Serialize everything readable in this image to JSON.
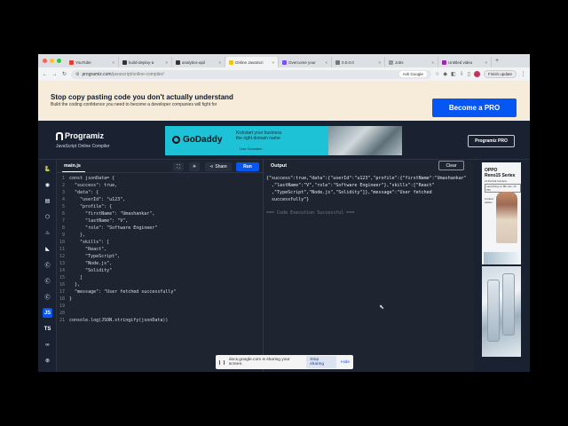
{
  "tabs": [
    {
      "label": "YouTube",
      "color": "#e53935"
    },
    {
      "label": "build-deploy-a",
      "color": "#333333"
    },
    {
      "label": "analytics-apil",
      "color": "#333333"
    },
    {
      "label": "Online JavaScri",
      "color": "#f0c419",
      "active": true
    },
    {
      "label": "Overcome your",
      "color": "#7c4dff"
    },
    {
      "label": "0.0.0.0",
      "color": "#777777"
    },
    {
      "label": "Jobs",
      "color": "#999999"
    },
    {
      "label": "Untitled video",
      "color": "#9c27b0"
    }
  ],
  "address": {
    "url_host": "programiz.com",
    "url_path": "/javascript/online-compiler/",
    "ask_google": "Ask Google",
    "finish_update": "Finish update"
  },
  "banner": {
    "heading": "Stop copy pasting code you don't actually understand",
    "subtext": "Build the coding confidence you need to become a developer companies will fight for",
    "cta": "Become a PRO"
  },
  "header": {
    "logo": "Programiz",
    "subtitle": "JavaScript Online Compiler",
    "ad_brand": "GoDaddy",
    "ad_line1": "Kickstart your business",
    "ad_line2": "the right domain name",
    "ad_credit": "Lisa Gonzales",
    "pro_button": "Programiz PRO"
  },
  "sidebar": {
    "active_language": "JS",
    "items": [
      "python",
      "r",
      "sql",
      "html",
      "java",
      "kotlin",
      "c",
      "cpp",
      "csharp",
      "JS",
      "TS",
      "go",
      "swift"
    ]
  },
  "editor": {
    "filename": "main.js",
    "share_label": "Share",
    "run_label": "Run",
    "lines": [
      {
        "n": "1",
        "text": "const jsonData= {"
      },
      {
        "n": "2",
        "text": "  \"success\": true,"
      },
      {
        "n": "3",
        "text": "  \"data\": {"
      },
      {
        "n": "4",
        "text": "    \"userId\": \"u123\","
      },
      {
        "n": "5",
        "text": "    \"profile\": {"
      },
      {
        "n": "6",
        "text": "      \"firstName\": \"Umashankar\","
      },
      {
        "n": "7",
        "text": "      \"lastName\": \"V\","
      },
      {
        "n": "8",
        "text": "      \"role\": \"Software Engineer\""
      },
      {
        "n": "9",
        "text": "    },"
      },
      {
        "n": "10",
        "text": "    \"skills\": ["
      },
      {
        "n": "11",
        "text": "      \"React\","
      },
      {
        "n": "12",
        "text": "      \"TypeScript\","
      },
      {
        "n": "13",
        "text": "      \"Node.js\","
      },
      {
        "n": "14",
        "text": "      \"Solidity\""
      },
      {
        "n": "15",
        "text": "    ]"
      },
      {
        "n": "16",
        "text": "  },"
      },
      {
        "n": "17",
        "text": "  \"message\": \"User fetched successfully\""
      },
      {
        "n": "18",
        "text": "}"
      },
      {
        "n": "19",
        "text": ""
      },
      {
        "n": "20",
        "text": ""
      },
      {
        "n": "21",
        "text": "console.log(JSON.stringify(jsonData))"
      }
    ]
  },
  "output": {
    "title": "Output",
    "clear_label": "Clear",
    "result": "{\"success\":true,\"data\":{\"userId\":\"u123\",\"profile\":{\"firstName\":\"Umashankar\"\n  ,\"lastName\":\"V\",\"role\":\"Software Engineer\"},\"skills\":[\"React\"\n  ,\"TypeScript\",\"Node.js\",\"Solidity\"]},\"message\":\"User fetched\n  successfully\"}",
    "status": "=== Code Execution Successful ==="
  },
  "right_ad": {
    "brand": "OPPO",
    "model": "Reno15 Series",
    "tag": "AI Portrait Camera",
    "launch": "Launching on 8th Jan, 12 PM",
    "side": "Limited edition"
  },
  "share_toast": {
    "message": "docs.google.com is sharing your screen.",
    "stop": "Stop sharing",
    "hide": "Hide"
  }
}
